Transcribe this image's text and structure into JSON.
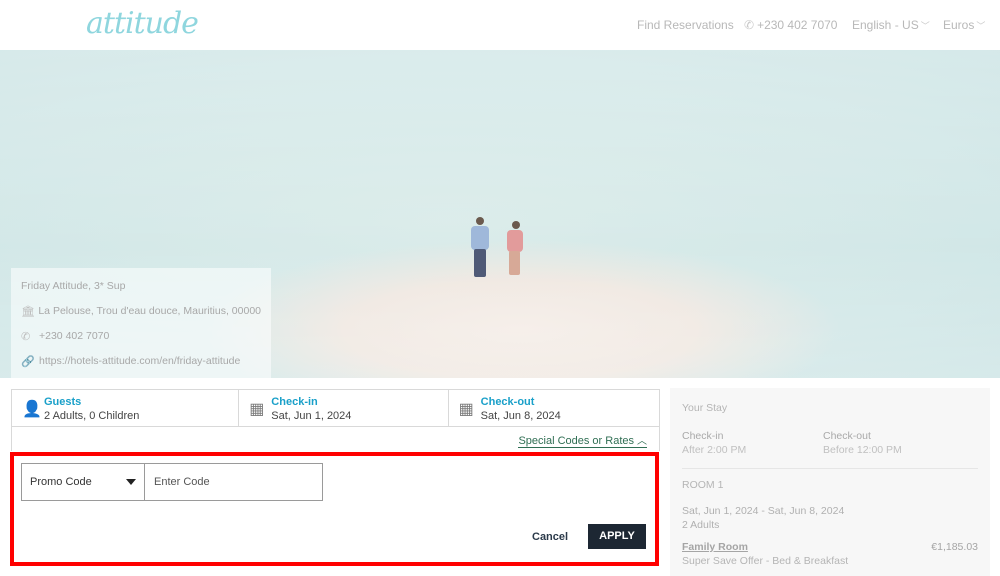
{
  "header": {
    "logo": "attitude",
    "find_reservations": "Find Reservations",
    "phone": "+230 402 7070",
    "language": "English - US",
    "currency": "Euros"
  },
  "hotel": {
    "name": "Friday Attitude, 3* Sup",
    "address": "La Pelouse, Trou d'eau douce, Mauritius, 00000",
    "phone": "+230 402 7070",
    "url": "https://hotels-attitude.com/en/friday-attitude"
  },
  "booking": {
    "guests_label": "Guests",
    "guests_value": "2 Adults, 0 Children",
    "checkin_label": "Check-in",
    "checkin_value": "Sat, Jun 1, 2024",
    "checkout_label": "Check-out",
    "checkout_value": "Sat, Jun 8, 2024",
    "special_codes": "Special Codes or Rates",
    "promo_type": "Promo Code",
    "code_placeholder": "Enter Code",
    "cancel_label": "Cancel",
    "apply_label": "APPLY"
  },
  "stay": {
    "title": "Your Stay",
    "checkin_label": "Check-in",
    "checkin_time": "After 2:00 PM",
    "checkout_label": "Check-out",
    "checkout_time": "Before 12:00 PM",
    "room_label": "ROOM 1",
    "dates": "Sat, Jun 1, 2024 - Sat, Jun 8, 2024",
    "adults": "2 Adults",
    "room_name": "Family Room",
    "price": "€1,185.03",
    "offer": "Super Save Offer - Bed & Breakfast"
  },
  "colors": {
    "accent_blue": "#1aa0c9",
    "link_green": "#2f6e53",
    "apply_bg": "#1d2733",
    "highlight_border": "#ff0000"
  }
}
